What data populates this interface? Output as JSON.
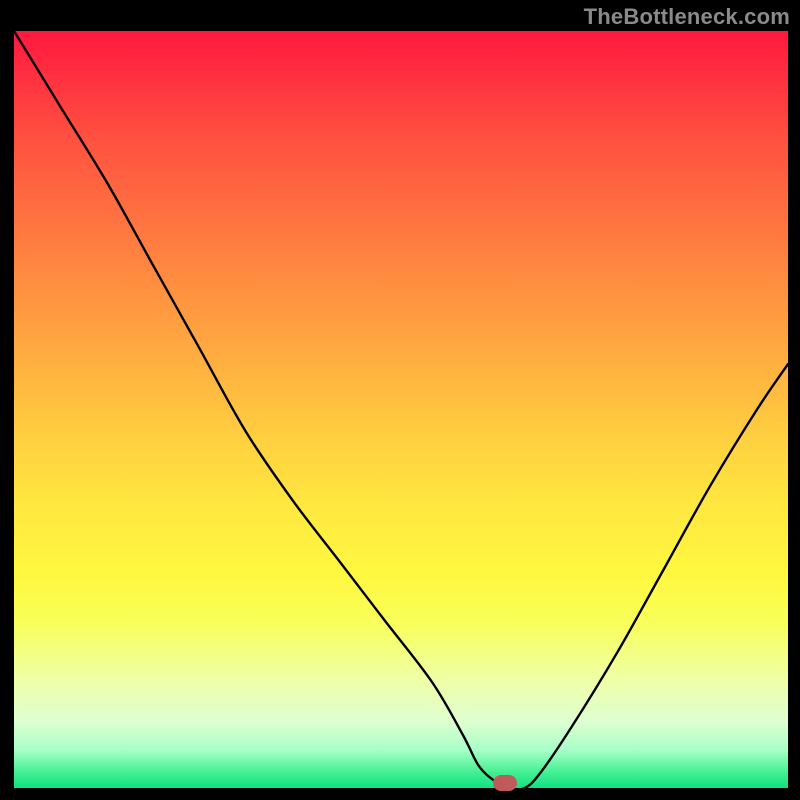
{
  "watermark": "TheBottleneck.com",
  "marker": {
    "x_frac": 0.635,
    "y_frac": 0.993
  },
  "chart_data": {
    "type": "line",
    "title": "",
    "xlabel": "",
    "ylabel": "",
    "xlim": [
      0,
      100
    ],
    "ylim": [
      0,
      100
    ],
    "grid": false,
    "legend": false,
    "series": [
      {
        "name": "bottleneck-curve",
        "x": [
          0,
          6,
          12,
          18,
          24,
          30,
          36,
          42,
          48,
          54,
          58,
          60,
          62,
          64,
          66,
          68,
          72,
          78,
          84,
          90,
          96,
          100
        ],
        "y": [
          100,
          90,
          80,
          69,
          58,
          47,
          38,
          30,
          22,
          14,
          7,
          3,
          1,
          0,
          0,
          2,
          8,
          18,
          29,
          40,
          50,
          56
        ]
      }
    ],
    "annotations": [
      {
        "type": "marker",
        "shape": "pill",
        "color": "#c15a5a",
        "x": 63.5,
        "y": 0
      }
    ],
    "background_gradient": {
      "type": "vertical",
      "stops": [
        {
          "pos": 0.0,
          "color": "#ff183f"
        },
        {
          "pos": 0.5,
          "color": "#ffd040"
        },
        {
          "pos": 0.78,
          "color": "#f8ff58"
        },
        {
          "pos": 1.0,
          "color": "#10e085"
        }
      ]
    }
  }
}
